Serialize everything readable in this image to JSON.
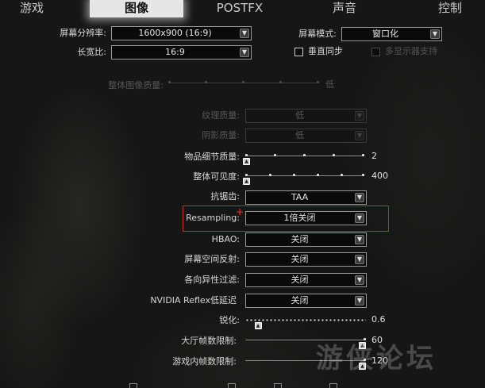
{
  "tabs": [
    {
      "label": "游戏"
    },
    {
      "label": "图像"
    },
    {
      "label": "POSTFX"
    },
    {
      "label": "声音"
    },
    {
      "label": "控制"
    }
  ],
  "top": {
    "resolution_label": "屏幕分辨率:",
    "resolution_value": "1600x900 (16:9)",
    "aspect_label": "长宽比:",
    "aspect_value": "16:9",
    "screen_mode_label": "屏幕模式:",
    "screen_mode_value": "窗口化",
    "vsync_label": "垂直同步",
    "multi_monitor_label": "多显示器支持"
  },
  "overall_quality": {
    "label": "整体图像质量:",
    "value": "低"
  },
  "texture_quality": {
    "label": "纹理质量:",
    "value": "低"
  },
  "shadow_quality": {
    "label": "阴影质量:",
    "value": "低"
  },
  "object_lod": {
    "label": "物品细节质量:",
    "value": "2",
    "level": 0
  },
  "visibility": {
    "label": "整体可见度:",
    "value": "400",
    "level": 0
  },
  "antialiasing": {
    "label": "抗锯齿:",
    "value": "TAA"
  },
  "resampling": {
    "label": "Resampling:",
    "value": "1倍关闭"
  },
  "hbao": {
    "label": "HBAO:",
    "value": "关闭"
  },
  "ssr": {
    "label": "屏幕空间反射:",
    "value": "关闭"
  },
  "anisotropic": {
    "label": "各向异性过滤:",
    "value": "关闭"
  },
  "reflex": {
    "label": "NVIDIA Reflex低延迟",
    "value": "关闭"
  },
  "sharpen": {
    "label": "锐化:",
    "value": "0.6",
    "level": 0.1
  },
  "lobby_fps": {
    "label": "大厅帧数限制:",
    "value": "60",
    "level": 1
  },
  "ingame_fps": {
    "label": "游戏内帧数限制:",
    "value": "120",
    "level": 1
  },
  "icons": {
    "chevron": "chevron-down-icon",
    "handle": "slider-handle-icon"
  },
  "colors": {
    "highlight": "#cc2a2a",
    "active_tab_bg": "#e6e6e6"
  },
  "watermark": "游侠论坛"
}
